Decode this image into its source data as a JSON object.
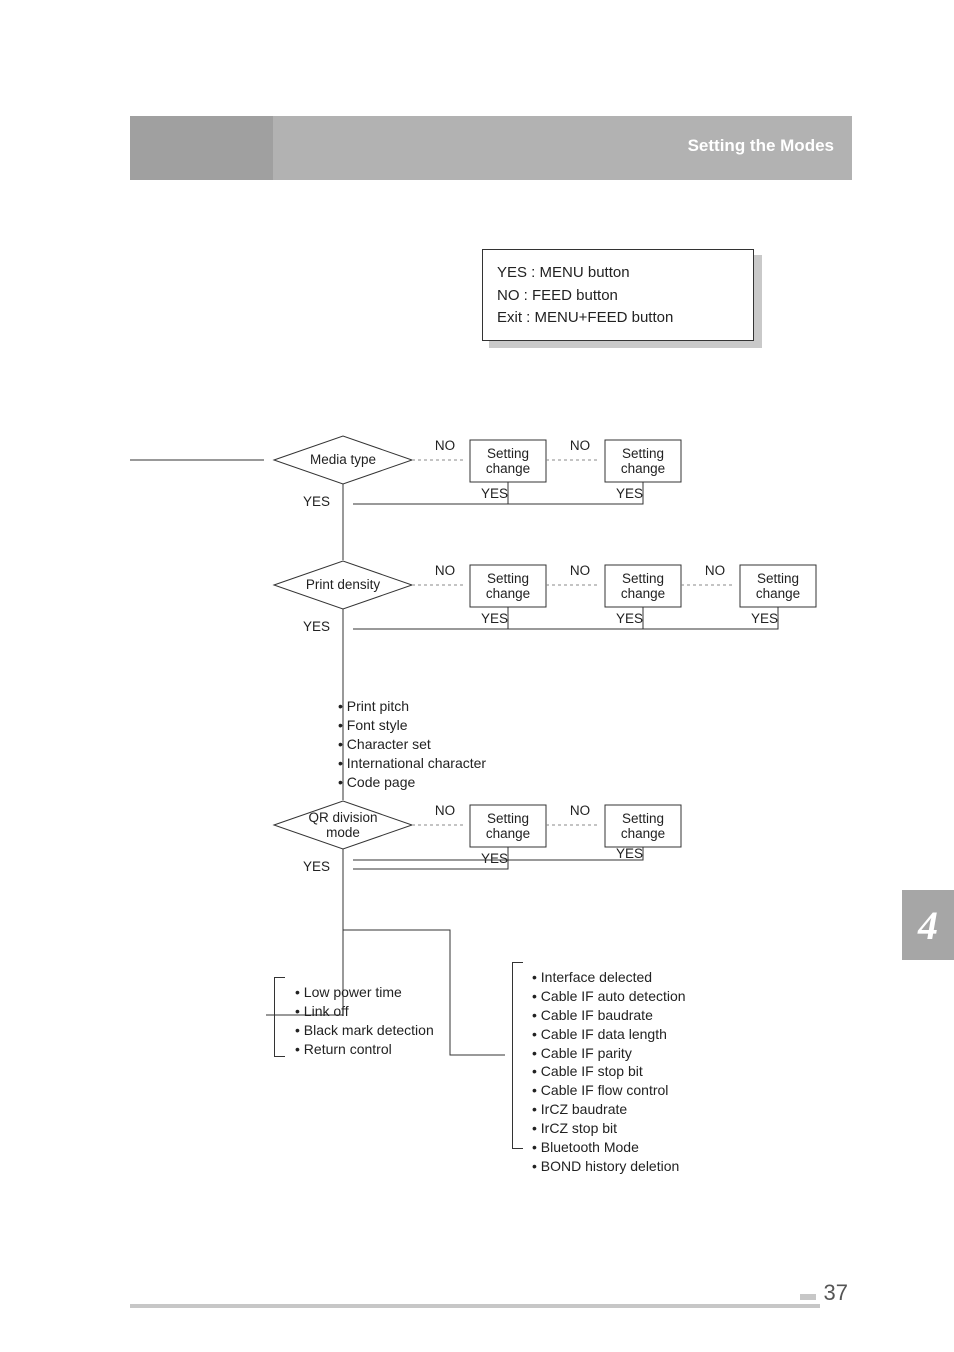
{
  "header": {
    "title": "Setting the Modes"
  },
  "legend": {
    "l1": "YES : MENU button",
    "l2": "NO  : FEED button",
    "l3": "Exit : MENU+FEED button"
  },
  "labels": {
    "yes": "YES",
    "no": "NO",
    "setting": "Setting",
    "change": "change"
  },
  "decisions": {
    "d1": "Media type",
    "d2": "Print density",
    "d3a": "QR division",
    "d3b": "mode"
  },
  "midlist": {
    "i1": "• Print pitch",
    "i2": "• Font style",
    "i3": "• Character set",
    "i4": "• International character",
    "i5": "• Code page"
  },
  "leftlist": {
    "i1": "• Low power time",
    "i2": "• Link off",
    "i3": "• Black mark detection",
    "i4": "• Return control"
  },
  "rightlist": {
    "i1": "• Interface delected",
    "i2": "• Cable IF auto detection",
    "i3": "• Cable IF baudrate",
    "i4": "• Cable IF data length",
    "i5": "• Cable IF parity",
    "i6": "• Cable IF stop bit",
    "i7": "• Cable IF flow control",
    "i8": "• IrCZ baudrate",
    "i9": "• IrCZ stop bit",
    "i10": "• Bluetooth Mode",
    "i11": "• BOND history deletion"
  },
  "tab": "4",
  "pagenum": "37",
  "chart_data": {
    "type": "flowchart",
    "legend": [
      "YES : MENU button",
      "NO : FEED button",
      "Exit : MENU+FEED button"
    ],
    "nodes": [
      {
        "id": "mediaType",
        "kind": "decision",
        "label": "Media type"
      },
      {
        "id": "mt_s1",
        "kind": "process",
        "label": "Setting change"
      },
      {
        "id": "mt_s2",
        "kind": "process",
        "label": "Setting change"
      },
      {
        "id": "printDensity",
        "kind": "decision",
        "label": "Print density"
      },
      {
        "id": "pd_s1",
        "kind": "process",
        "label": "Setting change"
      },
      {
        "id": "pd_s2",
        "kind": "process",
        "label": "Setting change"
      },
      {
        "id": "pd_s3",
        "kind": "process",
        "label": "Setting change"
      },
      {
        "id": "midSeq",
        "kind": "sequence",
        "items": [
          "Print pitch",
          "Font style",
          "Character set",
          "International character",
          "Code page"
        ]
      },
      {
        "id": "qrDiv",
        "kind": "decision",
        "label": "QR division mode"
      },
      {
        "id": "qr_s1",
        "kind": "process",
        "label": "Setting change"
      },
      {
        "id": "qr_s2",
        "kind": "process",
        "label": "Setting change"
      },
      {
        "id": "leftSeq",
        "kind": "sequence",
        "items": [
          "Low power time",
          "Link off",
          "Black mark detection",
          "Return control"
        ]
      },
      {
        "id": "rightSeq",
        "kind": "sequence",
        "items": [
          "Interface delected",
          "Cable IF auto detection",
          "Cable IF baudrate",
          "Cable IF data length",
          "Cable IF parity",
          "Cable IF stop bit",
          "Cable IF flow control",
          "IrCZ baudrate",
          "IrCZ stop bit",
          "Bluetooth Mode",
          "BOND history deletion"
        ]
      }
    ],
    "edges": [
      {
        "from": "mediaType",
        "to": "mt_s1",
        "label": "NO"
      },
      {
        "from": "mt_s1",
        "to": "mt_s2",
        "label": "NO"
      },
      {
        "from": "mt_s1",
        "to": "mediaType",
        "label": "YES"
      },
      {
        "from": "mt_s2",
        "to": "mediaType",
        "label": "YES"
      },
      {
        "from": "mediaType",
        "to": "printDensity",
        "label": "YES"
      },
      {
        "from": "printDensity",
        "to": "pd_s1",
        "label": "NO"
      },
      {
        "from": "pd_s1",
        "to": "pd_s2",
        "label": "NO"
      },
      {
        "from": "pd_s2",
        "to": "pd_s3",
        "label": "NO"
      },
      {
        "from": "pd_s1",
        "to": "printDensity",
        "label": "YES"
      },
      {
        "from": "pd_s2",
        "to": "printDensity",
        "label": "YES"
      },
      {
        "from": "pd_s3",
        "to": "printDensity",
        "label": "YES"
      },
      {
        "from": "printDensity",
        "to": "midSeq",
        "label": "YES"
      },
      {
        "from": "midSeq",
        "to": "qrDiv",
        "label": ""
      },
      {
        "from": "qrDiv",
        "to": "qr_s1",
        "label": "NO"
      },
      {
        "from": "qr_s1",
        "to": "qr_s2",
        "label": "NO"
      },
      {
        "from": "qr_s1",
        "to": "qrDiv",
        "label": "YES"
      },
      {
        "from": "qr_s2",
        "to": "qrDiv",
        "label": "YES"
      },
      {
        "from": "qrDiv",
        "to": "leftSeq",
        "label": "YES"
      },
      {
        "from": "qrDiv",
        "to": "rightSeq",
        "label": "YES"
      }
    ]
  }
}
